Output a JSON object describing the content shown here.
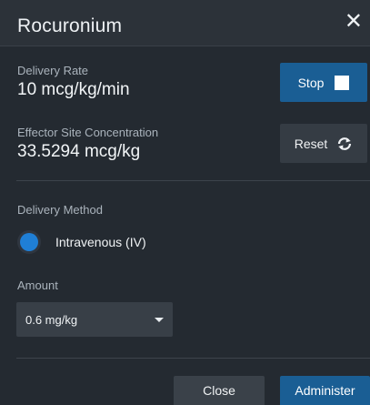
{
  "header": {
    "title": "Rocuronium",
    "close_glyph": "✕"
  },
  "delivery_rate": {
    "label": "Delivery Rate",
    "value": "10 mcg/kg/min"
  },
  "effector_site": {
    "label": "Effector Site Concentration",
    "value": "33.5294 mcg/kg"
  },
  "buttons": {
    "stop": "Stop",
    "reset": "Reset",
    "close": "Close",
    "administer": "Administer"
  },
  "delivery_method": {
    "label": "Delivery Method",
    "option": "Intravenous (IV)",
    "selected": true
  },
  "amount": {
    "label": "Amount",
    "selected": "0.6 mg/kg"
  },
  "icons": {
    "stop": "stop-square-icon",
    "reset": "refresh-icon",
    "close": "close-icon",
    "caret": "caret-down-icon"
  },
  "colors": {
    "background": "#242a31",
    "header": "#2c3239",
    "primary_button": "#1a5e94",
    "secondary_button": "#353c44",
    "radio_selected": "#1f7fd6"
  }
}
